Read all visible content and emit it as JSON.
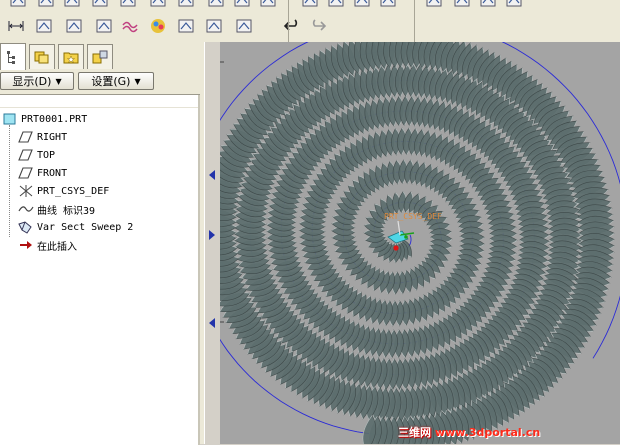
{
  "top_toolbar": {
    "icons": [
      "sketch-icon",
      "view-orient-icon",
      "layers-icon",
      "save-view-icon",
      "refit-icon",
      "zoom-in-icon",
      "zoom-out-icon",
      "repaint-icon",
      "spin-center-icon",
      "model-tree-display-icon",
      "wireframe-icon",
      "hidden-line-icon",
      "no-hidden-icon",
      "shading-icon",
      "datum-planes-icon",
      "datum-axes-icon",
      "datum-points-icon",
      "csys-icon"
    ]
  },
  "second_toolbar": {
    "icons": [
      "dimension-icon",
      "hole-icon",
      "shell-icon",
      "analysis-icon",
      "curvature-icon",
      "appearance-icon",
      "cut-icon",
      "mass-props-icon",
      "pattern-icon",
      "undo-icon",
      "redo-icon"
    ]
  },
  "left_panel": {
    "tabs": [
      "model-tree-tab",
      "folder-browser-tab",
      "favorites-tab",
      "connections-tab"
    ],
    "show_menu": "显示(D)",
    "settings_menu": "设置(G)",
    "tree": [
      {
        "label": "PRT0001.PRT",
        "icon": "part-icon"
      },
      {
        "label": "RIGHT",
        "icon": "datum-plane-icon"
      },
      {
        "label": "TOP",
        "icon": "datum-plane-icon"
      },
      {
        "label": "FRONT",
        "icon": "datum-plane-icon"
      },
      {
        "label": "PRT_CSYS_DEF",
        "icon": "csys-icon"
      },
      {
        "label": "曲线 标识39",
        "icon": "curve-icon"
      },
      {
        "label": "Var Sect Sweep 2",
        "icon": "sweep-icon"
      },
      {
        "label": "在此插入",
        "icon": "insert-here-icon"
      }
    ]
  },
  "viewport": {
    "csys_label": "PRT_CSYS_DEF",
    "background": "#a4a4a4",
    "spiral_color": "#2b2bd6",
    "surface_color": "#5d6e6e"
  },
  "watermark": {
    "cn": "三维网",
    "url": "www.3dportal.cn"
  }
}
